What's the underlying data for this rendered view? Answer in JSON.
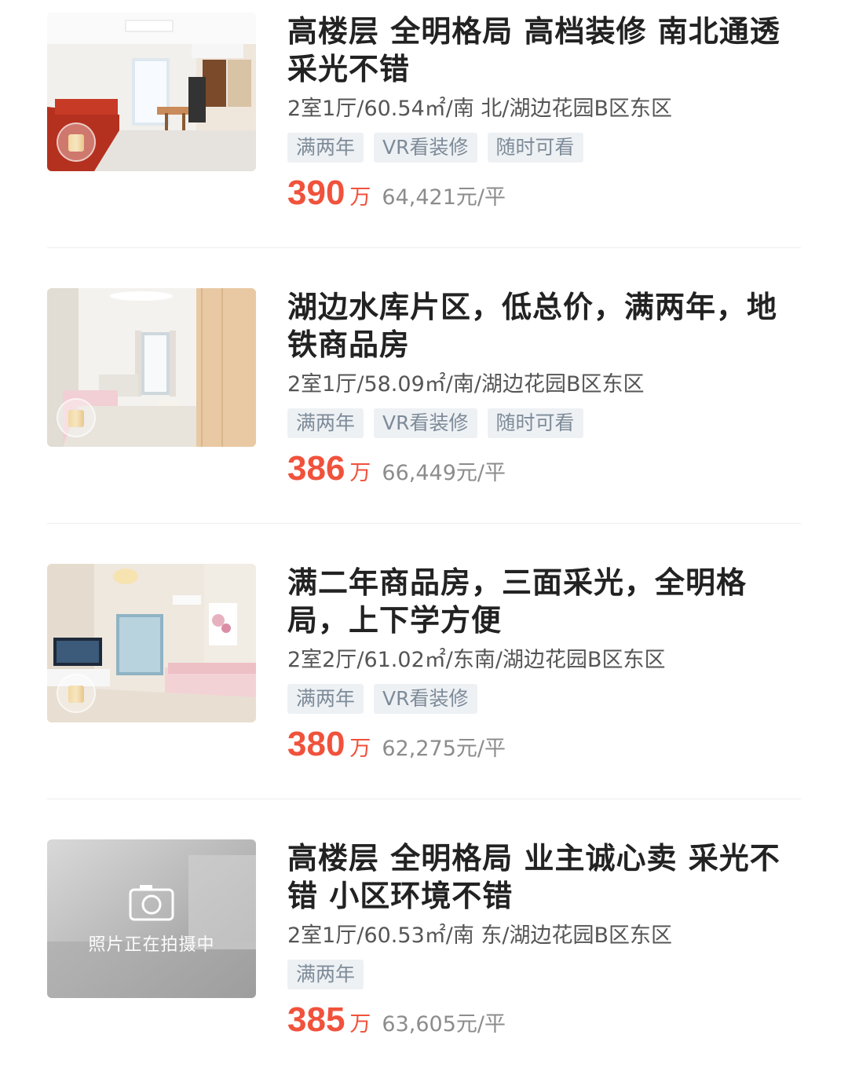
{
  "listings": [
    {
      "title": "高楼层 全明格局 高档装修 南北通透采光不错",
      "meta": "2室1厅/60.54㎡/南 北/湖边花园B区东区",
      "tags": [
        "满两年",
        "VR看装修",
        "随时可看"
      ],
      "price": "390",
      "price_unit": "万",
      "unit_price": "64,421元/平",
      "photo": "living-room-photo",
      "has_vr_badge": true
    },
    {
      "title": "湖边水库片区，低总价，满两年，地铁商品房",
      "meta": "2室1厅/58.09㎡/南/湖边花园B区东区",
      "tags": [
        "满两年",
        "VR看装修",
        "随时可看"
      ],
      "price": "386",
      "price_unit": "万",
      "unit_price": "66,449元/平",
      "photo": "living-room-photo",
      "has_vr_badge": true
    },
    {
      "title": "满二年商品房，三面采光，全明格局，上下学方便",
      "meta": "2室2厅/61.02㎡/东南/湖边花园B区东区",
      "tags": [
        "满两年",
        "VR看装修"
      ],
      "price": "380",
      "price_unit": "万",
      "unit_price": "62,275元/平",
      "photo": "living-room-photo",
      "has_vr_badge": true
    },
    {
      "title": "高楼层 全明格局 业主诚心卖 采光不错 小区环境不错",
      "meta": "2室1厅/60.53㎡/南 东/湖边花园B区东区",
      "tags": [
        "满两年"
      ],
      "price": "385",
      "price_unit": "万",
      "unit_price": "63,605元/平",
      "photo": "photo-placeholder",
      "placeholder_text": "照片正在拍摄中",
      "has_vr_badge": false
    }
  ],
  "colors": {
    "price": "#f0523c",
    "tag_bg": "#eef1f4",
    "tag_text": "#7d8b99",
    "title": "#222222",
    "meta": "#555555",
    "unit_price": "#8c8c8c"
  }
}
